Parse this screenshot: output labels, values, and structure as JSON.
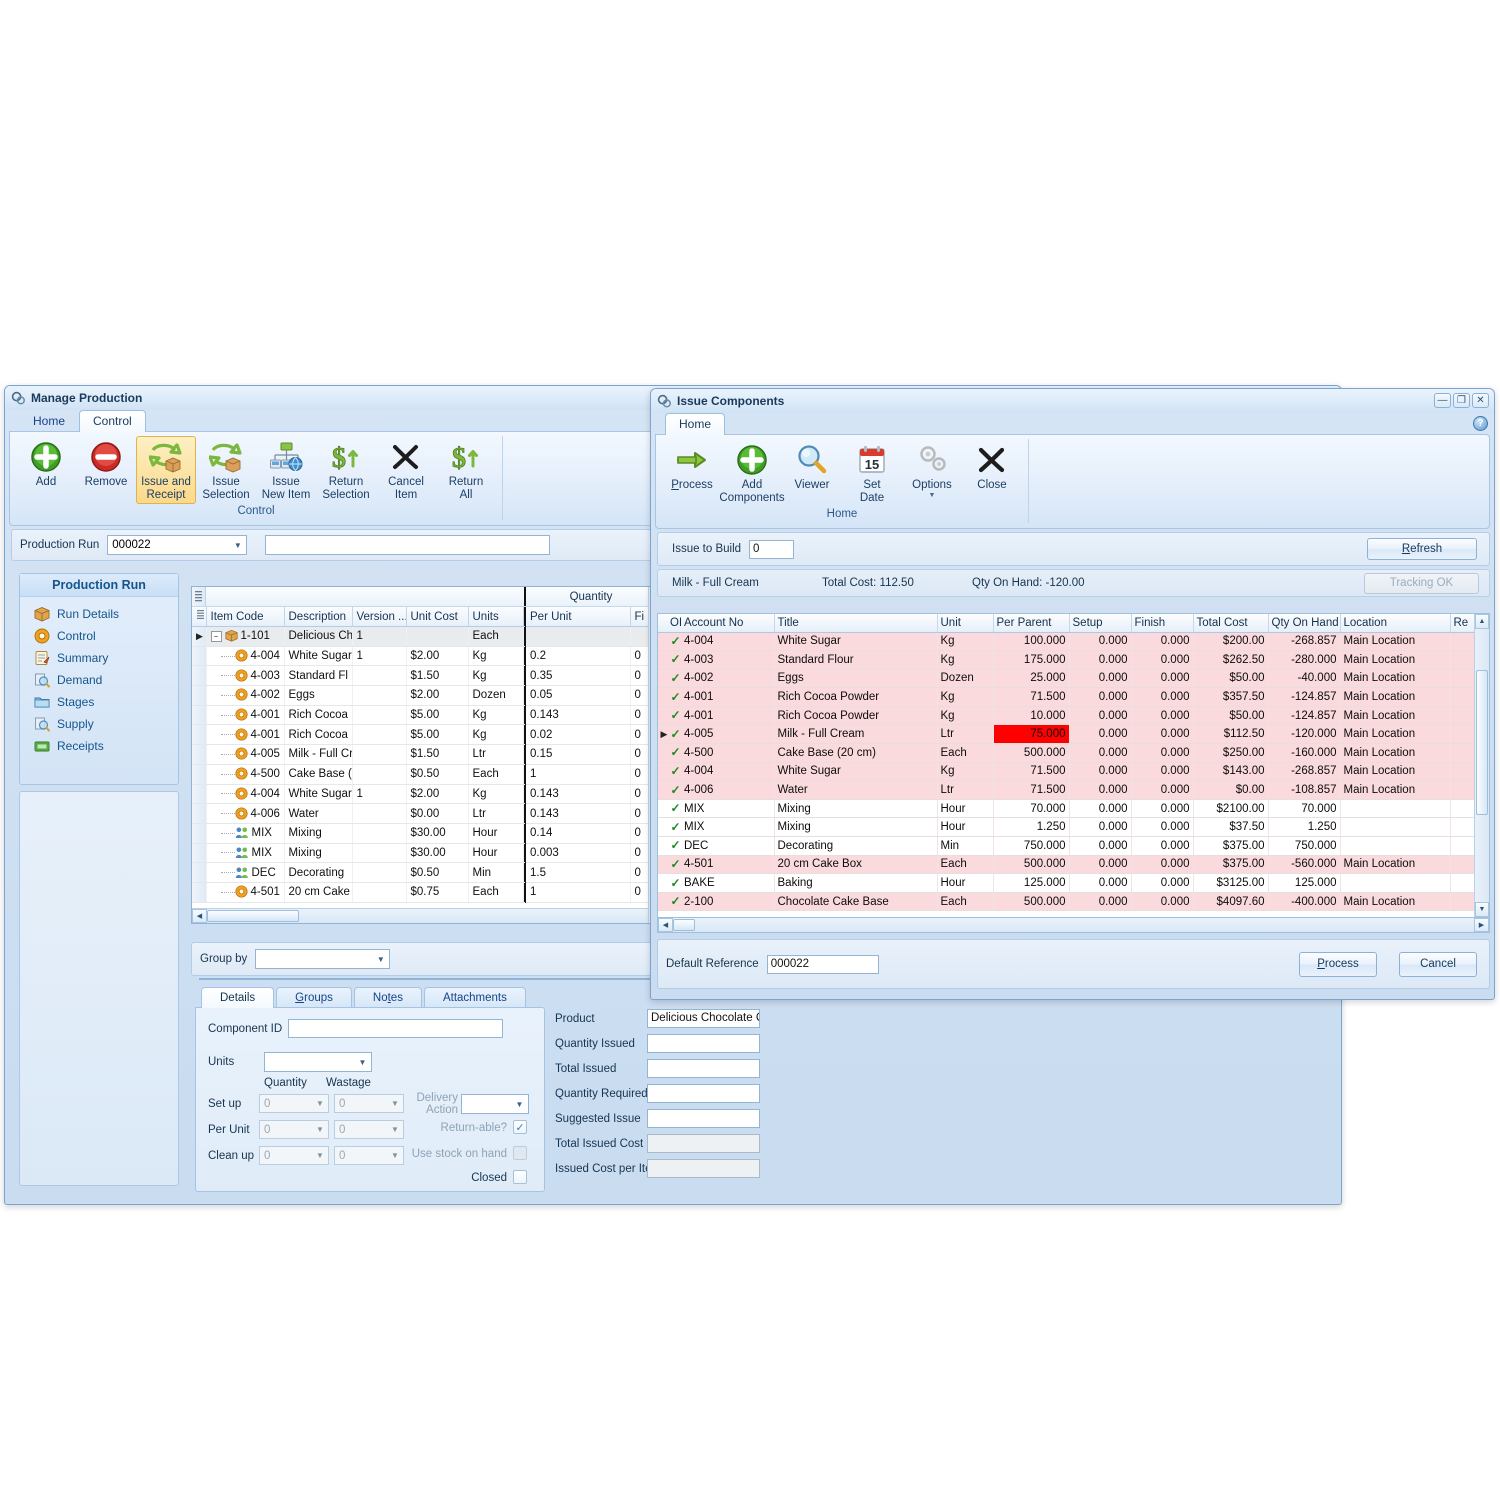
{
  "manage_production": {
    "title": "Manage Production",
    "tabs": [
      {
        "label": "Home",
        "active": false
      },
      {
        "label": "Control",
        "active": true
      }
    ],
    "ribbon": {
      "group_label": "Control",
      "buttons": [
        {
          "label_line1": "Add",
          "label_line2": "",
          "icon": "add-green-plus-icon",
          "selected": false
        },
        {
          "label_line1": "Remove",
          "label_line2": "",
          "icon": "remove-red-minus-icon",
          "selected": false
        },
        {
          "label_line1": "Issue and",
          "label_line2": "Receipt",
          "icon": "issue-receipt-arrows-icon",
          "selected": true
        },
        {
          "label_line1": "Issue",
          "label_line2": "Selection",
          "icon": "issue-selection-arrows-icon",
          "selected": false
        },
        {
          "label_line1": "Issue",
          "label_line2": "New Item",
          "icon": "issue-new-item-network-icon",
          "selected": false
        },
        {
          "label_line1": "Return",
          "label_line2": "Selection",
          "icon": "return-selection-dollar-icon",
          "selected": false
        },
        {
          "label_line1": "Cancel",
          "label_line2": "Item",
          "icon": "cancel-item-x-icon",
          "selected": false
        },
        {
          "label_line1": "Return",
          "label_line2": "All",
          "icon": "return-all-dollar-icon",
          "selected": false
        }
      ]
    },
    "production_run": {
      "label": "Production Run",
      "value": "000022",
      "search_value": ""
    },
    "nav": {
      "header": "Production Run",
      "items": [
        {
          "label": "Run Details",
          "icon": "package-box-icon"
        },
        {
          "label": "Control",
          "icon": "gear-orange-icon"
        },
        {
          "label": "Summary",
          "icon": "summary-clipboard-icon"
        },
        {
          "label": "Demand",
          "icon": "demand-magnifier-icon"
        },
        {
          "label": "Stages",
          "icon": "stages-folder-icon"
        },
        {
          "label": "Supply",
          "icon": "supply-magnifier-icon"
        },
        {
          "label": "Receipts",
          "icon": "receipts-money-icon"
        }
      ]
    },
    "grid": {
      "group_header": "Quantity",
      "columns": [
        "Item Code",
        "Description",
        "Version ...",
        "Unit Cost",
        "Units",
        "Per Unit",
        "Fi"
      ],
      "rows": [
        {
          "item_code": "1-101",
          "description": "Delicious Ch",
          "version": "1",
          "unit_cost": "",
          "units": "Each",
          "per_unit": "",
          "fi": "",
          "icon": "package-box-icon",
          "root": true
        },
        {
          "item_code": "4-004",
          "description": "White Sugar",
          "version": "1",
          "unit_cost": "$2.00",
          "units": "Kg",
          "per_unit": "0.2",
          "fi": "0",
          "icon": "gear-orange-icon"
        },
        {
          "item_code": "4-003",
          "description": "Standard Fl",
          "version": "",
          "unit_cost": "$1.50",
          "units": "Kg",
          "per_unit": "0.35",
          "fi": "0",
          "icon": "gear-orange-icon"
        },
        {
          "item_code": "4-002",
          "description": "Eggs",
          "version": "",
          "unit_cost": "$2.00",
          "units": "Dozen",
          "per_unit": "0.05",
          "fi": "0",
          "icon": "gear-orange-icon"
        },
        {
          "item_code": "4-001",
          "description": "Rich Cocoa",
          "version": "",
          "unit_cost": "$5.00",
          "units": "Kg",
          "per_unit": "0.143",
          "fi": "0",
          "icon": "gear-orange-icon"
        },
        {
          "item_code": "4-001",
          "description": "Rich Cocoa",
          "version": "",
          "unit_cost": "$5.00",
          "units": "Kg",
          "per_unit": "0.02",
          "fi": "0",
          "icon": "gear-orange-icon"
        },
        {
          "item_code": "4-005",
          "description": "Milk - Full Cr",
          "version": "",
          "unit_cost": "$1.50",
          "units": "Ltr",
          "per_unit": "0.15",
          "fi": "0",
          "icon": "gear-orange-icon"
        },
        {
          "item_code": "4-500",
          "description": "Cake Base (",
          "version": "",
          "unit_cost": "$0.50",
          "units": "Each",
          "per_unit": "1",
          "fi": "0",
          "icon": "gear-orange-icon"
        },
        {
          "item_code": "4-004",
          "description": "White Sugar",
          "version": "1",
          "unit_cost": "$2.00",
          "units": "Kg",
          "per_unit": "0.143",
          "fi": "0",
          "icon": "gear-orange-icon"
        },
        {
          "item_code": "4-006",
          "description": "Water",
          "version": "",
          "unit_cost": "$0.00",
          "units": "Ltr",
          "per_unit": "0.143",
          "fi": "0",
          "icon": "gear-orange-icon"
        },
        {
          "item_code": "MIX",
          "description": "Mixing",
          "version": "",
          "unit_cost": "$30.00",
          "units": "Hour",
          "per_unit": "0.14",
          "fi": "0",
          "icon": "people-icon"
        },
        {
          "item_code": "MIX",
          "description": "Mixing",
          "version": "",
          "unit_cost": "$30.00",
          "units": "Hour",
          "per_unit": "0.003",
          "fi": "0",
          "icon": "people-icon"
        },
        {
          "item_code": "DEC",
          "description": "Decorating",
          "version": "",
          "unit_cost": "$0.50",
          "units": "Min",
          "per_unit": "1.5",
          "fi": "0",
          "icon": "people-icon"
        },
        {
          "item_code": "4-501",
          "description": "20 cm Cake",
          "version": "",
          "unit_cost": "$0.75",
          "units": "Each",
          "per_unit": "1",
          "fi": "0",
          "icon": "gear-orange-icon"
        }
      ]
    },
    "group_by": {
      "label": "Group by",
      "value": ""
    },
    "bottom_tabs": [
      {
        "label": "Details",
        "active": true
      },
      {
        "label": "Groups",
        "active": false
      },
      {
        "label": "Notes",
        "active": false
      },
      {
        "label": "Attachments",
        "active": false
      }
    ],
    "details": {
      "component_id_label": "Component ID",
      "component_id_value": "",
      "units_label": "Units",
      "units_value": "",
      "col_quantity": "Quantity",
      "col_wastage": "Wastage",
      "rows": [
        {
          "label": "Set up",
          "quantity": "0",
          "wastage": "0"
        },
        {
          "label": "Per Unit",
          "quantity": "0",
          "wastage": "0"
        },
        {
          "label": "Clean up",
          "quantity": "0",
          "wastage": "0"
        }
      ],
      "delivery_action_label": "Delivery Action",
      "delivery_action_value": "",
      "returnable_label": "Return-able?",
      "returnable_checked": true,
      "use_stock_label": "Use stock on hand",
      "use_stock_checked": false,
      "closed_label": "Closed",
      "closed_checked": false
    },
    "product_panel": [
      {
        "label": "Product",
        "value": "Delicious Chocolate Cake (Staged",
        "readonly": false
      },
      {
        "label": "Quantity Issued",
        "value": "",
        "readonly": false
      },
      {
        "label": "Total Issued",
        "value": "",
        "readonly": false
      },
      {
        "label": "Quantity Required",
        "value": "",
        "readonly": false
      },
      {
        "label": "Suggested Issue",
        "value": "",
        "readonly": false
      },
      {
        "label": "Total Issued Cost",
        "value": "",
        "readonly": true
      },
      {
        "label": "Issued Cost per Item",
        "value": "",
        "readonly": true
      }
    ]
  },
  "issue_components": {
    "title": "Issue Components",
    "window_buttons": [
      "minimize-button",
      "maximize-button",
      "close-button"
    ],
    "tabs": [
      {
        "label": "Home",
        "active": true
      }
    ],
    "ribbon": {
      "group_label": "Home",
      "buttons": [
        {
          "label_line1": "Process",
          "label_line2": "",
          "icon": "process-arrow-icon",
          "underline_first": true
        },
        {
          "label_line1": "Add",
          "label_line2": "Components",
          "icon": "add-green-plus-icon"
        },
        {
          "label_line1": "Viewer",
          "label_line2": "",
          "icon": "magnifier-icon"
        },
        {
          "label_line1": "Set",
          "label_line2": "Date",
          "icon": "calendar-15-icon"
        },
        {
          "label_line1": "Options",
          "label_line2": "",
          "icon": "gears-icon",
          "has_dropdown": true
        },
        {
          "label_line1": "Close",
          "label_line2": "",
          "icon": "close-x-icon"
        }
      ]
    },
    "toolbar": {
      "issue_to_build_label": "Issue to Build",
      "issue_to_build_value": "0",
      "refresh_label": "Refresh"
    },
    "status": {
      "item": "Milk - Full Cream",
      "total_cost": "Total Cost: 112.50",
      "qty_on_hand": "Qty On Hand: -120.00",
      "tracking": "Tracking OK"
    },
    "grid": {
      "columns": [
        "OK",
        "Account No",
        "Title",
        "Unit",
        "Per Parent",
        "Setup",
        "Finish",
        "Total Cost",
        "Qty On Hand",
        "Location",
        "Re"
      ],
      "rows": [
        {
          "ok": true,
          "account_no": "4-004",
          "title": "White Sugar",
          "unit": "Kg",
          "per_parent": "100.000",
          "setup": "0.000",
          "finish": "0.000",
          "total_cost": "$200.00",
          "qty_on_hand": "-268.857",
          "location": "Main Location",
          "re": "",
          "shade": "pink",
          "selected": false,
          "hot": false
        },
        {
          "ok": true,
          "account_no": "4-003",
          "title": "Standard Flour",
          "unit": "Kg",
          "per_parent": "175.000",
          "setup": "0.000",
          "finish": "0.000",
          "total_cost": "$262.50",
          "qty_on_hand": "-280.000",
          "location": "Main Location",
          "re": "",
          "shade": "pink",
          "selected": false,
          "hot": false
        },
        {
          "ok": true,
          "account_no": "4-002",
          "title": "Eggs",
          "unit": "Dozen",
          "per_parent": "25.000",
          "setup": "0.000",
          "finish": "0.000",
          "total_cost": "$50.00",
          "qty_on_hand": "-40.000",
          "location": "Main Location",
          "re": "",
          "shade": "pink",
          "selected": false,
          "hot": false
        },
        {
          "ok": true,
          "account_no": "4-001",
          "title": "Rich Cocoa Powder",
          "unit": "Kg",
          "per_parent": "71.500",
          "setup": "0.000",
          "finish": "0.000",
          "total_cost": "$357.50",
          "qty_on_hand": "-124.857",
          "location": "Main Location",
          "re": "",
          "shade": "pink",
          "selected": false,
          "hot": false
        },
        {
          "ok": true,
          "account_no": "4-001",
          "title": "Rich Cocoa Powder",
          "unit": "Kg",
          "per_parent": "10.000",
          "setup": "0.000",
          "finish": "0.000",
          "total_cost": "$50.00",
          "qty_on_hand": "-124.857",
          "location": "Main Location",
          "re": "",
          "shade": "pink",
          "selected": false,
          "hot": false
        },
        {
          "ok": true,
          "account_no": "4-005",
          "title": "Milk - Full Cream",
          "unit": "Ltr",
          "per_parent": "75.000",
          "setup": "0.000",
          "finish": "0.000",
          "total_cost": "$112.50",
          "qty_on_hand": "-120.000",
          "location": "Main Location",
          "re": "",
          "shade": "pink",
          "selected": true,
          "hot": true
        },
        {
          "ok": true,
          "account_no": "4-500",
          "title": "Cake Base (20 cm)",
          "unit": "Each",
          "per_parent": "500.000",
          "setup": "0.000",
          "finish": "0.000",
          "total_cost": "$250.00",
          "qty_on_hand": "-160.000",
          "location": "Main Location",
          "re": "",
          "shade": "pink",
          "selected": false,
          "hot": false
        },
        {
          "ok": true,
          "account_no": "4-004",
          "title": "White Sugar",
          "unit": "Kg",
          "per_parent": "71.500",
          "setup": "0.000",
          "finish": "0.000",
          "total_cost": "$143.00",
          "qty_on_hand": "-268.857",
          "location": "Main Location",
          "re": "",
          "shade": "pink",
          "selected": false,
          "hot": false
        },
        {
          "ok": true,
          "account_no": "4-006",
          "title": "Water",
          "unit": "Ltr",
          "per_parent": "71.500",
          "setup": "0.000",
          "finish": "0.000",
          "total_cost": "$0.00",
          "qty_on_hand": "-108.857",
          "location": "Main Location",
          "re": "",
          "shade": "pink",
          "selected": false,
          "hot": false
        },
        {
          "ok": true,
          "account_no": "MIX",
          "title": "Mixing",
          "unit": "Hour",
          "per_parent": "70.000",
          "setup": "0.000",
          "finish": "0.000",
          "total_cost": "$2100.00",
          "qty_on_hand": "70.000",
          "location": "",
          "re": "",
          "shade": "white",
          "selected": false,
          "hot": false
        },
        {
          "ok": true,
          "account_no": "MIX",
          "title": "Mixing",
          "unit": "Hour",
          "per_parent": "1.250",
          "setup": "0.000",
          "finish": "0.000",
          "total_cost": "$37.50",
          "qty_on_hand": "1.250",
          "location": "",
          "re": "",
          "shade": "white",
          "selected": false,
          "hot": false
        },
        {
          "ok": true,
          "account_no": "DEC",
          "title": "Decorating",
          "unit": "Min",
          "per_parent": "750.000",
          "setup": "0.000",
          "finish": "0.000",
          "total_cost": "$375.00",
          "qty_on_hand": "750.000",
          "location": "",
          "re": "",
          "shade": "white",
          "selected": false,
          "hot": false
        },
        {
          "ok": true,
          "account_no": "4-501",
          "title": "20 cm Cake Box",
          "unit": "Each",
          "per_parent": "500.000",
          "setup": "0.000",
          "finish": "0.000",
          "total_cost": "$375.00",
          "qty_on_hand": "-560.000",
          "location": "Main Location",
          "re": "",
          "shade": "pink",
          "selected": false,
          "hot": false
        },
        {
          "ok": true,
          "account_no": "BAKE",
          "title": "Baking",
          "unit": "Hour",
          "per_parent": "125.000",
          "setup": "0.000",
          "finish": "0.000",
          "total_cost": "$3125.00",
          "qty_on_hand": "125.000",
          "location": "",
          "re": "",
          "shade": "white",
          "selected": false,
          "hot": false
        },
        {
          "ok": true,
          "account_no": "2-100",
          "title": "Chocolate Cake Base",
          "unit": "Each",
          "per_parent": "500.000",
          "setup": "0.000",
          "finish": "0.000",
          "total_cost": "$4097.60",
          "qty_on_hand": "-400.000",
          "location": "Main Location",
          "re": "",
          "shade": "pink",
          "selected": false,
          "hot": false
        }
      ]
    },
    "footer": {
      "default_reference_label": "Default Reference",
      "default_reference_value": "000022",
      "process_label": "Process",
      "cancel_label": "Cancel"
    }
  },
  "colors": {
    "accent_blue": "#15558c",
    "highlight_red": "#ff0000",
    "row_pink": "#fadadd",
    "ribbon_selected": "#fbd98a",
    "check_green": "#1f8a24"
  }
}
